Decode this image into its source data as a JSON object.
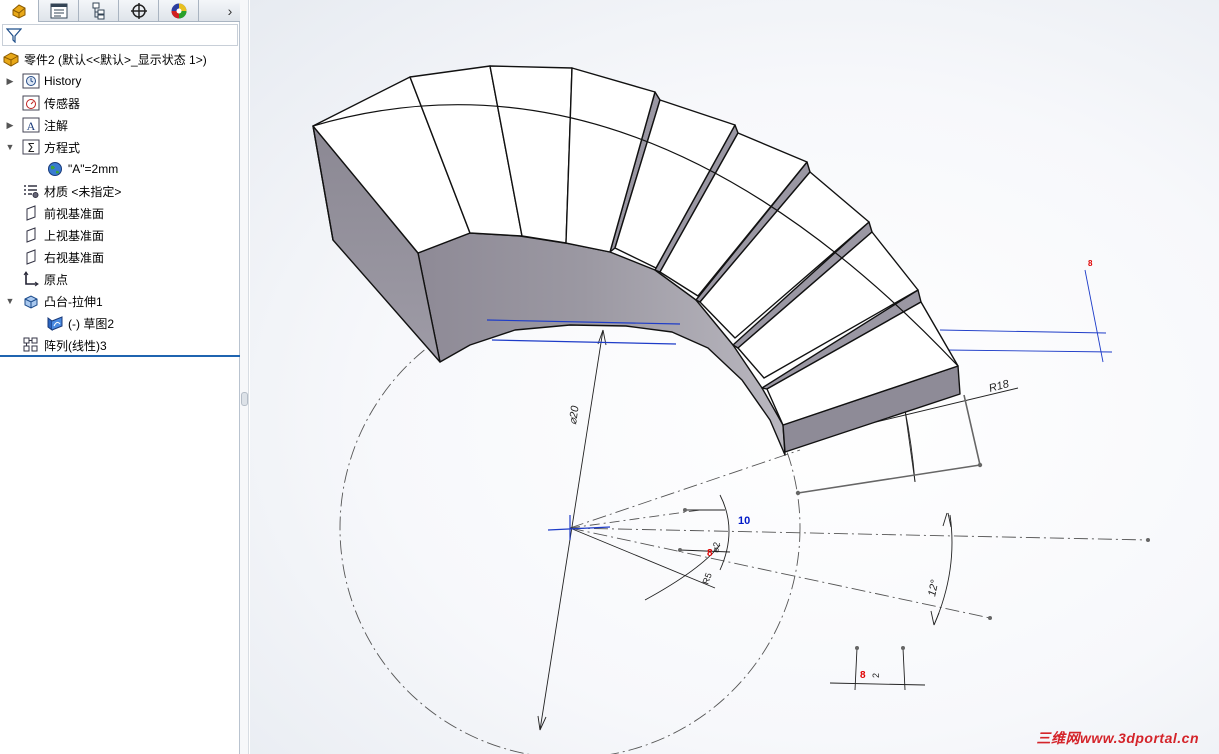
{
  "feature_tree": {
    "root_label": "零件2 (默认<<默认>_显示状态 1>)",
    "items": [
      {
        "label": "History"
      },
      {
        "label": "传感器"
      },
      {
        "label": "注解"
      },
      {
        "label": "方程式"
      },
      {
        "label": "\"A\"=2mm"
      },
      {
        "label": "材质 <未指定>"
      },
      {
        "label": "前视基准面"
      },
      {
        "label": "上视基准面"
      },
      {
        "label": "右视基准面"
      },
      {
        "label": "原点"
      },
      {
        "label": "凸台-拉伸1"
      },
      {
        "label": "(-) 草图2"
      },
      {
        "label": "阵列(线性)3"
      }
    ]
  },
  "dimensions": {
    "r18": "R18",
    "dia20": "⌀20",
    "ten": "10",
    "twelve_deg": "12°",
    "small_r": "R5",
    "small_d": "⌀2",
    "two": "2"
  },
  "watermark": "三维网www.3dportal.cn",
  "colors": {
    "selection_blue": "#1f64b0",
    "dimension_blue": "#0019c8",
    "accent_red": "#e00000"
  }
}
